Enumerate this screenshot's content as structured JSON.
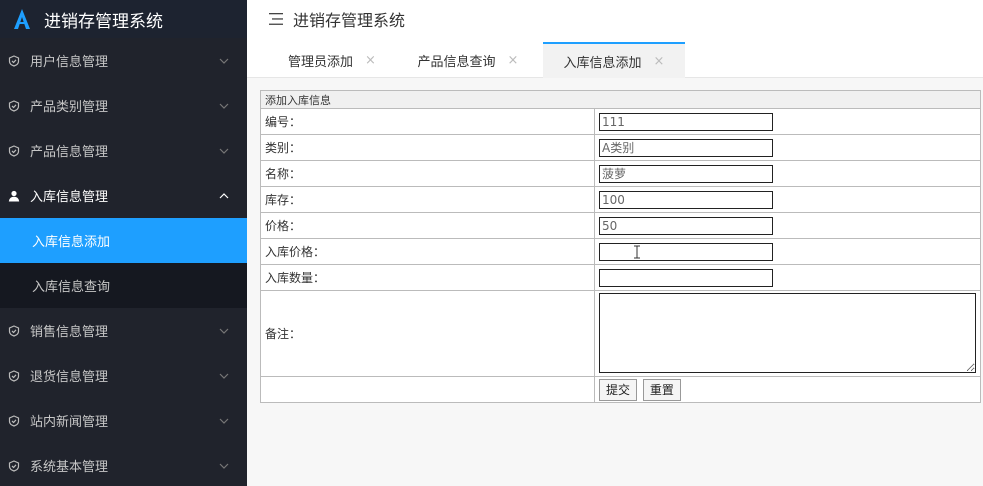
{
  "app": {
    "logo_text": "进销存管理系统"
  },
  "sidebar": {
    "items": [
      {
        "label": "用户信息管理"
      },
      {
        "label": "产品类别管理"
      },
      {
        "label": "产品信息管理"
      },
      {
        "label": "入库信息管理"
      }
    ],
    "sub_items": [
      {
        "label": "入库信息添加"
      },
      {
        "label": "入库信息查询"
      }
    ],
    "items_after": [
      {
        "label": "销售信息管理"
      },
      {
        "label": "退货信息管理"
      },
      {
        "label": "站内新闻管理"
      },
      {
        "label": "系统基本管理"
      }
    ]
  },
  "header": {
    "title": "进销存管理系统"
  },
  "tabs": [
    {
      "label": "管理员添加",
      "close": "×"
    },
    {
      "label": "产品信息查询",
      "close": "×"
    },
    {
      "label": "入库信息添加",
      "close": "×"
    }
  ],
  "form": {
    "section_title": "添加入库信息",
    "fields": [
      {
        "label": "编号：",
        "value": "111"
      },
      {
        "label": "类别：",
        "value": "A类别"
      },
      {
        "label": "名称：",
        "value": "菠萝"
      },
      {
        "label": "库存：",
        "value": "100"
      },
      {
        "label": "价格：",
        "value": "50"
      },
      {
        "label": "入库价格：",
        "value": ""
      },
      {
        "label": "入库数量：",
        "value": ""
      }
    ],
    "remark_label": "备注：",
    "submit_label": "提交",
    "reset_label": "重置"
  },
  "colors": {
    "sidebar_bg": "#20232c",
    "active": "#1e9fff"
  }
}
